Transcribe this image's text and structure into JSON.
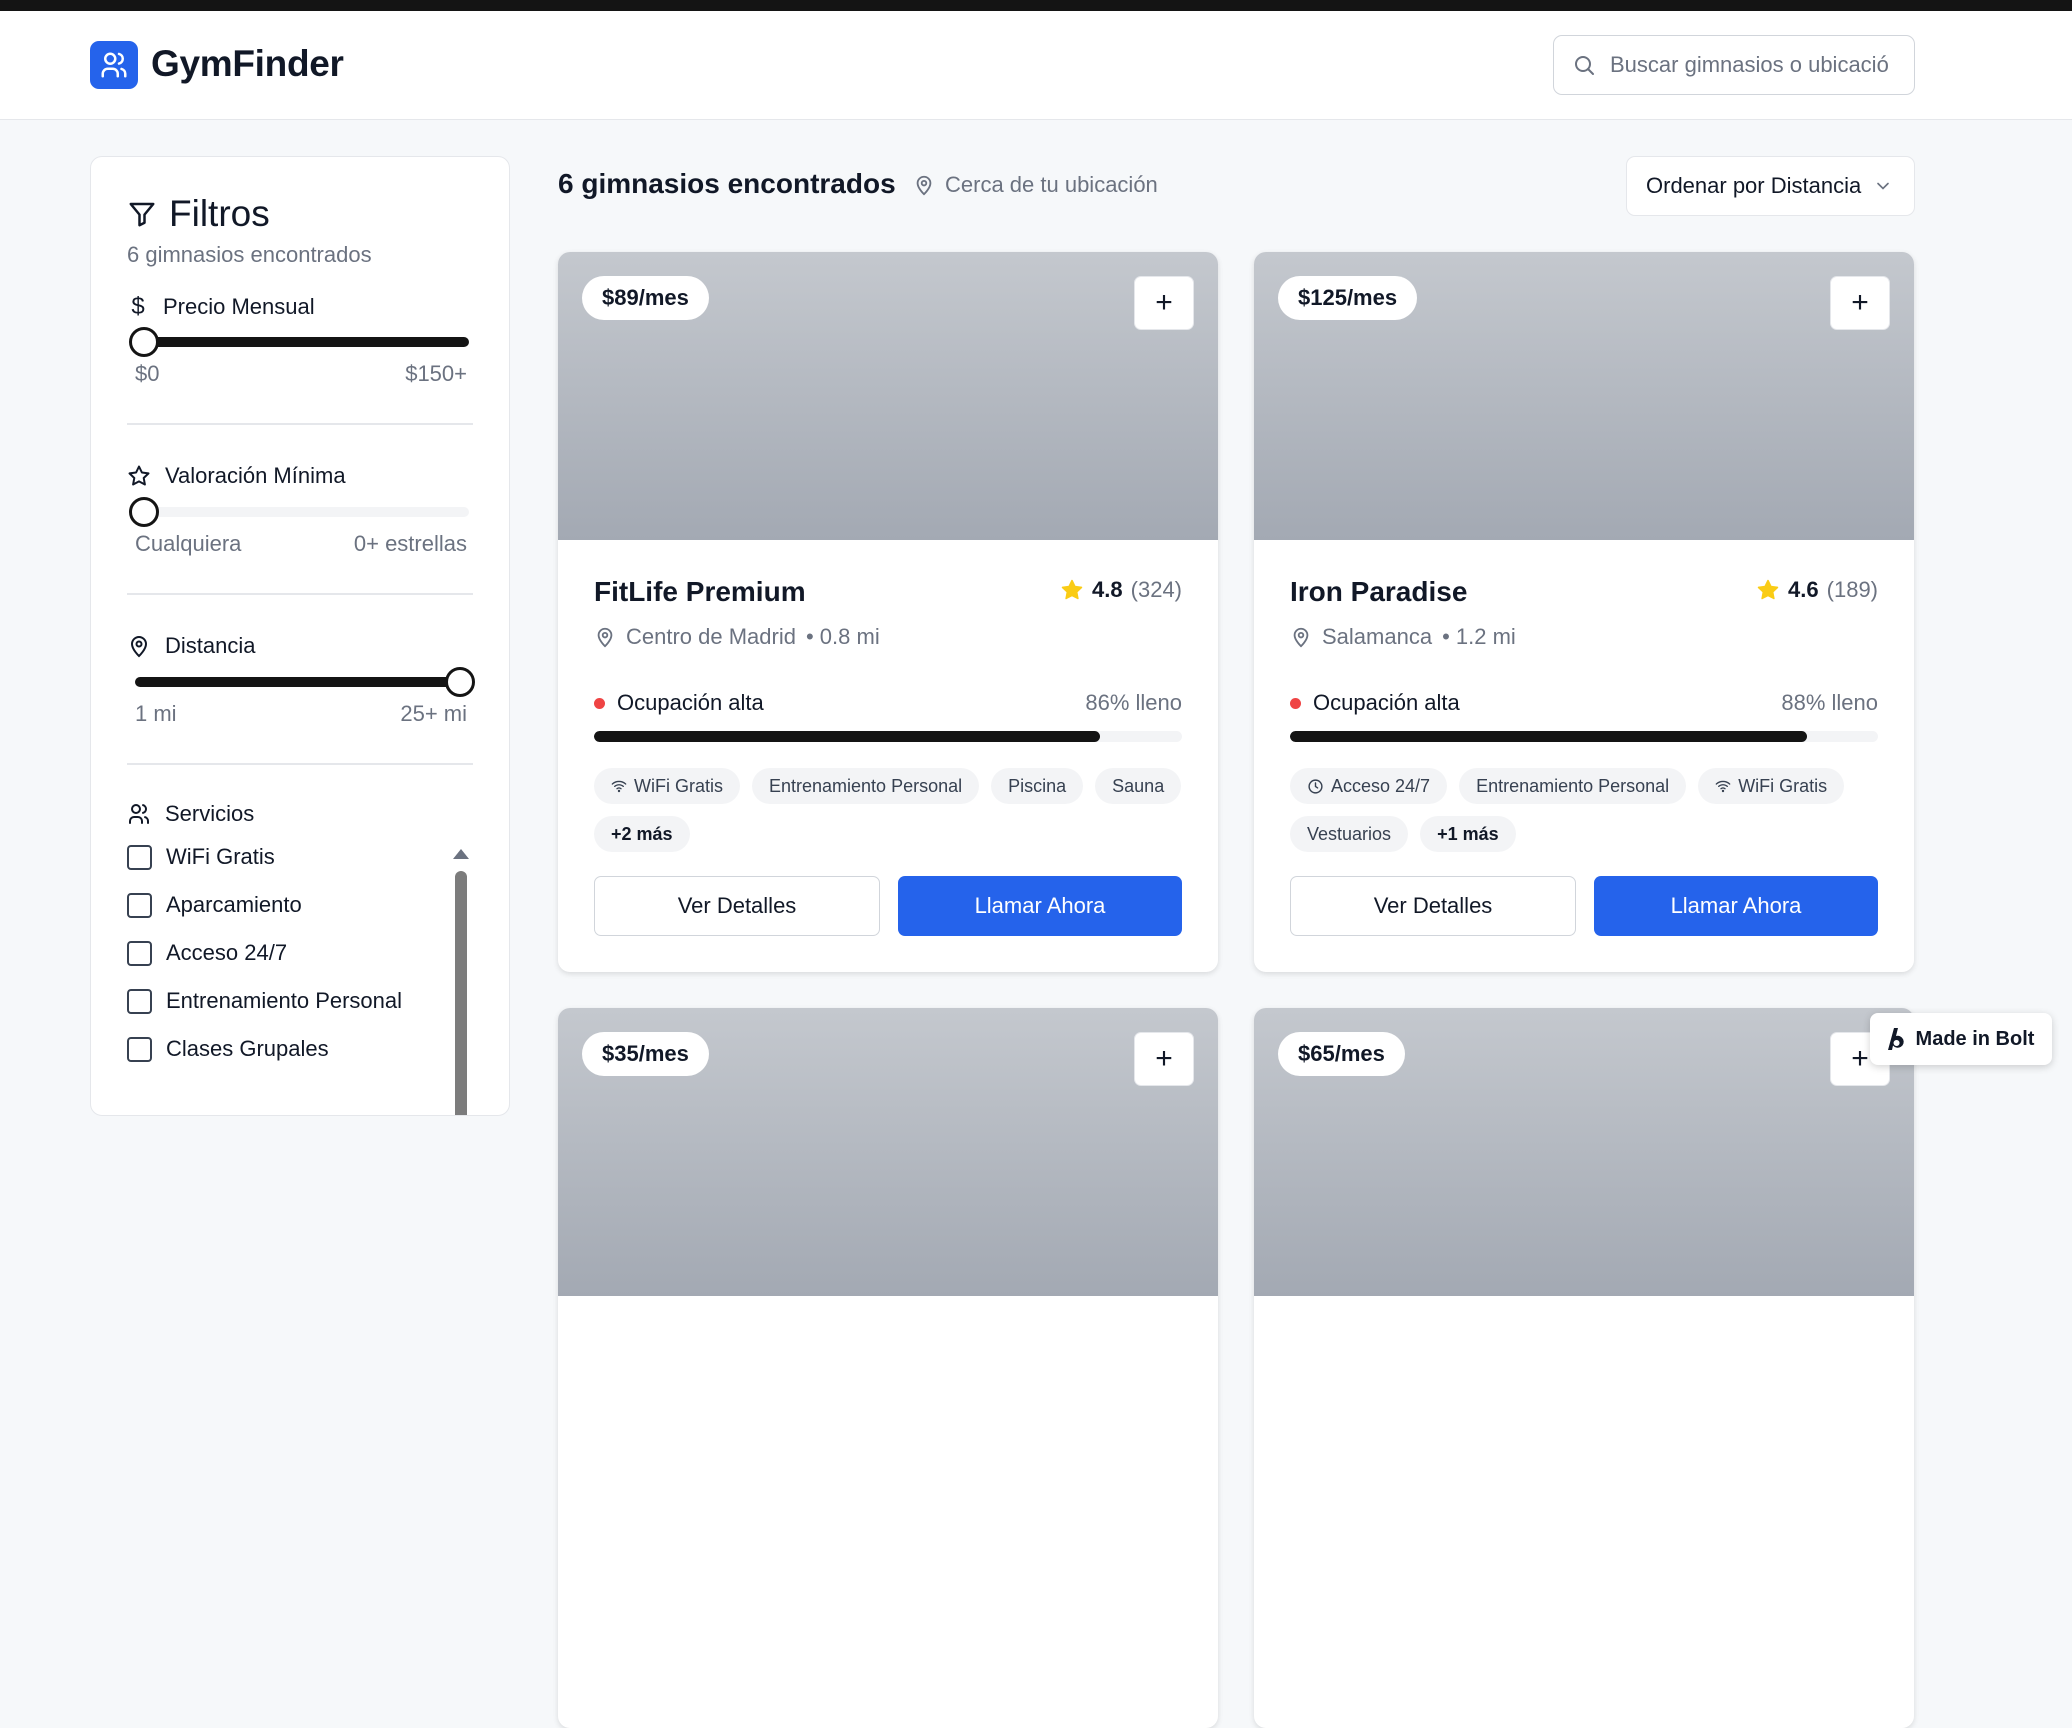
{
  "app": {
    "name": "GymFinder"
  },
  "search": {
    "placeholder": "Buscar gimnasios o ubicación"
  },
  "sidebar": {
    "title": "Filtros",
    "subtitle": "6 gimnasios encontrados",
    "price": {
      "label": "Precio Mensual",
      "min_label": "$0",
      "max_label": "$150+",
      "value_fraction": 0.0
    },
    "rating": {
      "label": "Valoración Mínima",
      "min_label": "Cualquiera",
      "max_label": "0+ estrellas",
      "value_fraction": 0.0
    },
    "distance": {
      "label": "Distancia",
      "min_label": "1 mi",
      "max_label": "25+ mi",
      "value_fraction": 1.0
    },
    "services": {
      "label": "Servicios",
      "items": [
        "WiFi Gratis",
        "Aparcamiento",
        "Acceso 24/7",
        "Entrenamiento Personal",
        "Clases Grupales"
      ]
    }
  },
  "results": {
    "count_label": "6 gimnasios encontrados",
    "location_label": "Cerca de tu ubicación",
    "sort_label": "Ordenar por Distancia"
  },
  "cards": [
    {
      "price": "$89/mes",
      "add": "+",
      "name": "FitLife Premium",
      "rating": "4.8",
      "reviews": "(324)",
      "area": "Centro de Madrid",
      "distance": "• 0.8 mi",
      "occupancy_label": "Ocupación alta",
      "occupancy_pct": "86% lleno",
      "occupancy_fraction": 0.86,
      "tags": [
        {
          "label": "WiFi Gratis",
          "icon": "wifi-icon"
        },
        {
          "label": "Entrenamiento Personal"
        },
        {
          "label": "Piscina"
        },
        {
          "label": "Sauna"
        },
        {
          "label": "+2 más",
          "more": true
        }
      ],
      "details": "Ver Detalles",
      "call": "Llamar Ahora"
    },
    {
      "price": "$125/mes",
      "add": "+",
      "name": "Iron Paradise",
      "rating": "4.6",
      "reviews": "(189)",
      "area": "Salamanca",
      "distance": "• 1.2 mi",
      "occupancy_label": "Ocupación alta",
      "occupancy_pct": "88% lleno",
      "occupancy_fraction": 0.88,
      "tags": [
        {
          "label": "Acceso 24/7",
          "icon": "clock-icon"
        },
        {
          "label": "Entrenamiento Personal"
        },
        {
          "label": "WiFi Gratis",
          "icon": "wifi-icon"
        },
        {
          "label": "Vestuarios"
        },
        {
          "label": "+1 más",
          "more": true
        }
      ],
      "details": "Ver Detalles",
      "call": "Llamar Ahora"
    },
    {
      "price": "$35/mes",
      "add": "+"
    },
    {
      "price": "$65/mes",
      "add": "+"
    }
  ],
  "badge": {
    "label": "Made in Bolt"
  },
  "colors": {
    "accent": "#2563eb",
    "danger": "#ef4444",
    "dark": "#141414"
  }
}
